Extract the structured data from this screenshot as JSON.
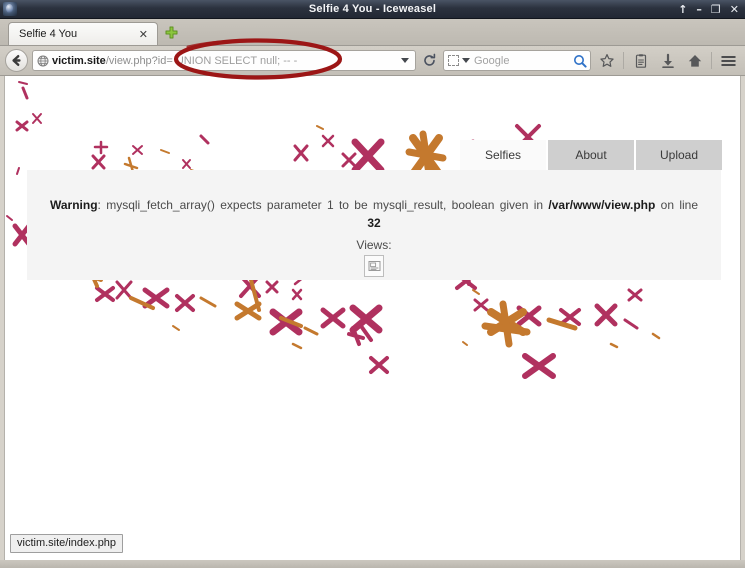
{
  "window": {
    "title": "Selfie 4 You - Iceweasel",
    "app_icon": "iceweasel-icon",
    "controls": {
      "shade": "↑",
      "minimize": "–",
      "maximize": "❐",
      "close": "✕"
    }
  },
  "tabs": {
    "items": [
      {
        "label": "Selfie 4 You",
        "close": "✕"
      }
    ],
    "new_tab_label": "+"
  },
  "navbar": {
    "back_label": "Back",
    "url": {
      "host": "victim.site",
      "path": "/view.php?id=",
      "query": " UNION SELECT null; -- -"
    },
    "dropdown_label": "▾",
    "reload_label": "Reload",
    "search": {
      "placeholder": "Google",
      "engine_label": "Search engine"
    },
    "icons": {
      "bookmark": "star-icon",
      "reader": "reader-icon",
      "downloads": "download-icon",
      "home": "home-icon",
      "menu": "hamburger-menu-icon"
    }
  },
  "annotation": {
    "shape": "ellipse",
    "color": "#9c1616",
    "target": "UNION SELECT null; -- -"
  },
  "page": {
    "nav_tabs": [
      {
        "label": "Selfies",
        "active": true
      },
      {
        "label": "About",
        "active": false
      },
      {
        "label": "Upload",
        "active": false
      }
    ],
    "warning": {
      "prefix": "Warning",
      "separator": ": ",
      "message_1": "mysqli_fetch_array() expects parameter 1 to be mysqli_result, boolean given in ",
      "file": "/var/www/view.php",
      "message_2": " on line ",
      "line": "32"
    },
    "views_label": "Views:",
    "broken_image_alt": "broken-image-icon"
  },
  "status": {
    "text": "victim.site/index.php"
  },
  "colors": {
    "titlebar": "#2b323e",
    "chrome": "#c9c5bd",
    "panel": "#f4f4f4",
    "tab_inactive": "#cfcfcf",
    "annotation_red": "#9c1616",
    "art_magenta": "#b03060",
    "art_orange": "#c8762e"
  }
}
